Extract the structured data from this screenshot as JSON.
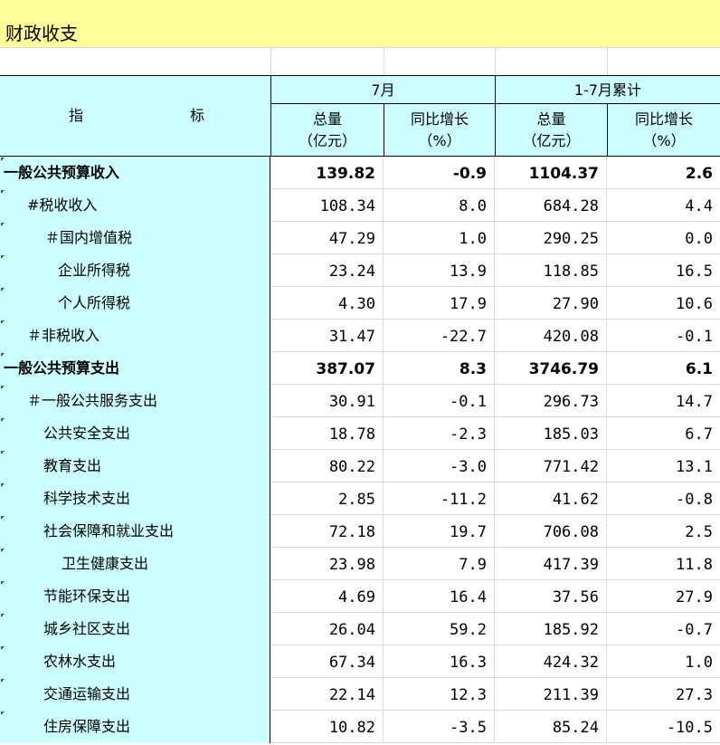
{
  "title": "财政收支",
  "header": {
    "indicator_left": "指",
    "indicator_right": "标",
    "group_month": "7月",
    "group_cumulative": "1-7月累计",
    "col_total": "总量",
    "col_total_unit": "（亿元）",
    "col_growth": "同比增长",
    "col_growth_unit": "（%）"
  },
  "rows": [
    {
      "name": "一般公共预算收入",
      "bold": true,
      "indent": 0,
      "month_total": "139.82",
      "month_growth": "-0.9",
      "cum_total": "1104.37",
      "cum_growth": "2.6"
    },
    {
      "name": "#税收收入",
      "bold": false,
      "indent": 1,
      "month_total": "108.34",
      "month_growth": "8.0",
      "cum_total": "684.28",
      "cum_growth": "4.4"
    },
    {
      "name": "＃国内增值税",
      "bold": false,
      "indent": 2,
      "month_total": "47.29",
      "month_growth": "1.0",
      "cum_total": "290.25",
      "cum_growth": "0.0"
    },
    {
      "name": "企业所得税",
      "bold": false,
      "indent": 3,
      "month_total": "23.24",
      "month_growth": "13.9",
      "cum_total": "118.85",
      "cum_growth": "16.5"
    },
    {
      "name": "个人所得税",
      "bold": false,
      "indent": 3,
      "month_total": "4.30",
      "month_growth": "17.9",
      "cum_total": "27.90",
      "cum_growth": "10.6"
    },
    {
      "name": "＃非税收入",
      "bold": false,
      "indent": 1,
      "month_total": "31.47",
      "month_growth": "-22.7",
      "cum_total": "420.08",
      "cum_growth": "-0.1"
    },
    {
      "name": "一般公共预算支出",
      "bold": true,
      "indent": 0,
      "month_total": "387.07",
      "month_growth": "8.3",
      "cum_total": "3746.79",
      "cum_growth": "6.1"
    },
    {
      "name": "＃一般公共服务支出",
      "bold": false,
      "indent": 1,
      "month_total": "30.91",
      "month_growth": "-0.1",
      "cum_total": "296.73",
      "cum_growth": "14.7"
    },
    {
      "name": "公共安全支出",
      "bold": false,
      "indent": 4,
      "month_total": "18.78",
      "month_growth": "-2.3",
      "cum_total": "185.03",
      "cum_growth": "6.7"
    },
    {
      "name": "教育支出",
      "bold": false,
      "indent": 4,
      "month_total": "80.22",
      "month_growth": "-3.0",
      "cum_total": "771.42",
      "cum_growth": "13.1"
    },
    {
      "name": "科学技术支出",
      "bold": false,
      "indent": 4,
      "month_total": "2.85",
      "month_growth": "-11.2",
      "cum_total": "41.62",
      "cum_growth": "-0.8"
    },
    {
      "name": "社会保障和就业支出",
      "bold": false,
      "indent": 4,
      "month_total": "72.18",
      "month_growth": "19.7",
      "cum_total": "706.08",
      "cum_growth": "2.5"
    },
    {
      "name": "卫生健康支出",
      "bold": false,
      "indent": 5,
      "month_total": "23.98",
      "month_growth": "7.9",
      "cum_total": "417.39",
      "cum_growth": "11.8"
    },
    {
      "name": "节能环保支出",
      "bold": false,
      "indent": 4,
      "month_total": "4.69",
      "month_growth": "16.4",
      "cum_total": "37.56",
      "cum_growth": "27.9"
    },
    {
      "name": "城乡社区支出",
      "bold": false,
      "indent": 4,
      "month_total": "26.04",
      "month_growth": "59.2",
      "cum_total": "185.92",
      "cum_growth": "-0.7"
    },
    {
      "name": "农林水支出",
      "bold": false,
      "indent": 4,
      "month_total": "67.34",
      "month_growth": "16.3",
      "cum_total": "424.32",
      "cum_growth": "1.0"
    },
    {
      "name": "交通运输支出",
      "bold": false,
      "indent": 4,
      "month_total": "22.14",
      "month_growth": "12.3",
      "cum_total": "211.39",
      "cum_growth": "27.3"
    },
    {
      "name": "住房保障支出",
      "bold": false,
      "indent": 4,
      "month_total": "10.82",
      "month_growth": "-3.5",
      "cum_total": "85.24",
      "cum_growth": "-10.5"
    }
  ]
}
